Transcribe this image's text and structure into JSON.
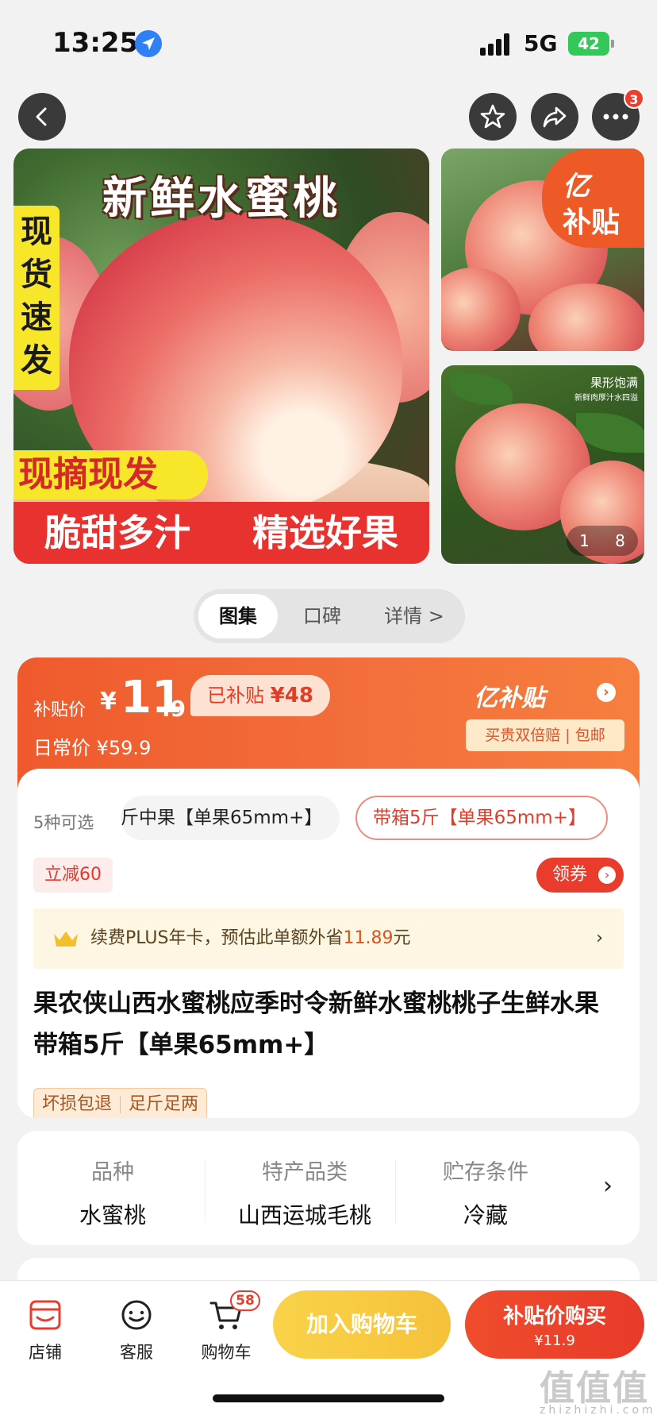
{
  "status_bar": {
    "time": "13:25",
    "network": "5G",
    "battery": "42"
  },
  "nav": {
    "more_badge": "3"
  },
  "gallery": {
    "main_title": "新鲜水蜜桃",
    "vertical_tag": "现货速发",
    "pick_tag": "现摘现发",
    "band_left": "脆甜多汁",
    "band_right": "精选好果",
    "corner_line1": "亿",
    "corner_line2": "补贴",
    "side2_caption": "果形饱满",
    "side2_sub": "新鲜肉厚汁水四溢",
    "page_current": "1",
    "page_total": "8"
  },
  "tabs": [
    {
      "label": "图集"
    },
    {
      "label": "口碑"
    },
    {
      "label": "详情 >"
    }
  ],
  "price": {
    "label": "补贴价",
    "currency": "¥",
    "integer": "11",
    "decimal": ".9",
    "subsidized_label": "已补贴",
    "subsidized_amount": "¥48",
    "regular": "日常价 ¥59.9",
    "brand": "亿补贴",
    "brand_tags": "买贵双倍赔 | 包邮"
  },
  "specs": {
    "count": "5种可选",
    "option1": "斤中果【单果65mm+】",
    "option2": "带箱5斤【单果65mm+】"
  },
  "discount": {
    "tag": "立减60",
    "coupon": "领券"
  },
  "plus": {
    "text": "续费PLUS年卡，预估此单额外省",
    "amount": "11.89",
    "unit": "元"
  },
  "product": {
    "title": "果农侠山西水蜜桃应季时令新鲜水蜜桃桃子生鲜水果 带箱5斤【单果65mm+】"
  },
  "services": [
    "坏损包退",
    "足斤足两"
  ],
  "attributes": [
    {
      "key": "品种",
      "value": "水蜜桃"
    },
    {
      "key": "特产品类",
      "value": "山西运城毛桃"
    },
    {
      "key": "贮存条件",
      "value": "冷藏"
    }
  ],
  "bottom_bar": {
    "store": "店铺",
    "service": "客服",
    "cart": "购物车",
    "cart_count": "58",
    "add_to_cart": "加入购物车",
    "buy_label": "补贴价购买",
    "buy_price": "¥11.9"
  },
  "watermark": {
    "main": "值值值",
    "sub": "zhizhizhi.com"
  },
  "colors": {
    "accent": "#e93c2d",
    "subsidy_orange": "#ef5a2d",
    "cart_yellow": "#f6c13a"
  }
}
